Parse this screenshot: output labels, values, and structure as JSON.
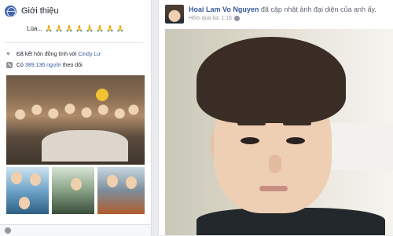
{
  "intro": {
    "title": "Giới thiệu",
    "bio_text": "Lúa...",
    "married_prefix": "Đã kết hôn đồng tính với",
    "married_name": "Cindy Lư",
    "followers_prefix": "Có",
    "followers_count": "389.136 người",
    "followers_suffix": "theo dõi"
  },
  "post": {
    "author": "Hoai Lam Vo Nguyen",
    "action": "đã cập nhật ảnh đại diện của anh ấy.",
    "timestamp": "Hôm qua lúc 1:16"
  },
  "icons": {
    "intro": "globe-icon",
    "married": "heart-icon",
    "followers": "rss-icon",
    "audience": "globe-icon"
  },
  "colors": {
    "link": "#365899",
    "accent": "#4267b2",
    "background": "#e9ebee"
  }
}
